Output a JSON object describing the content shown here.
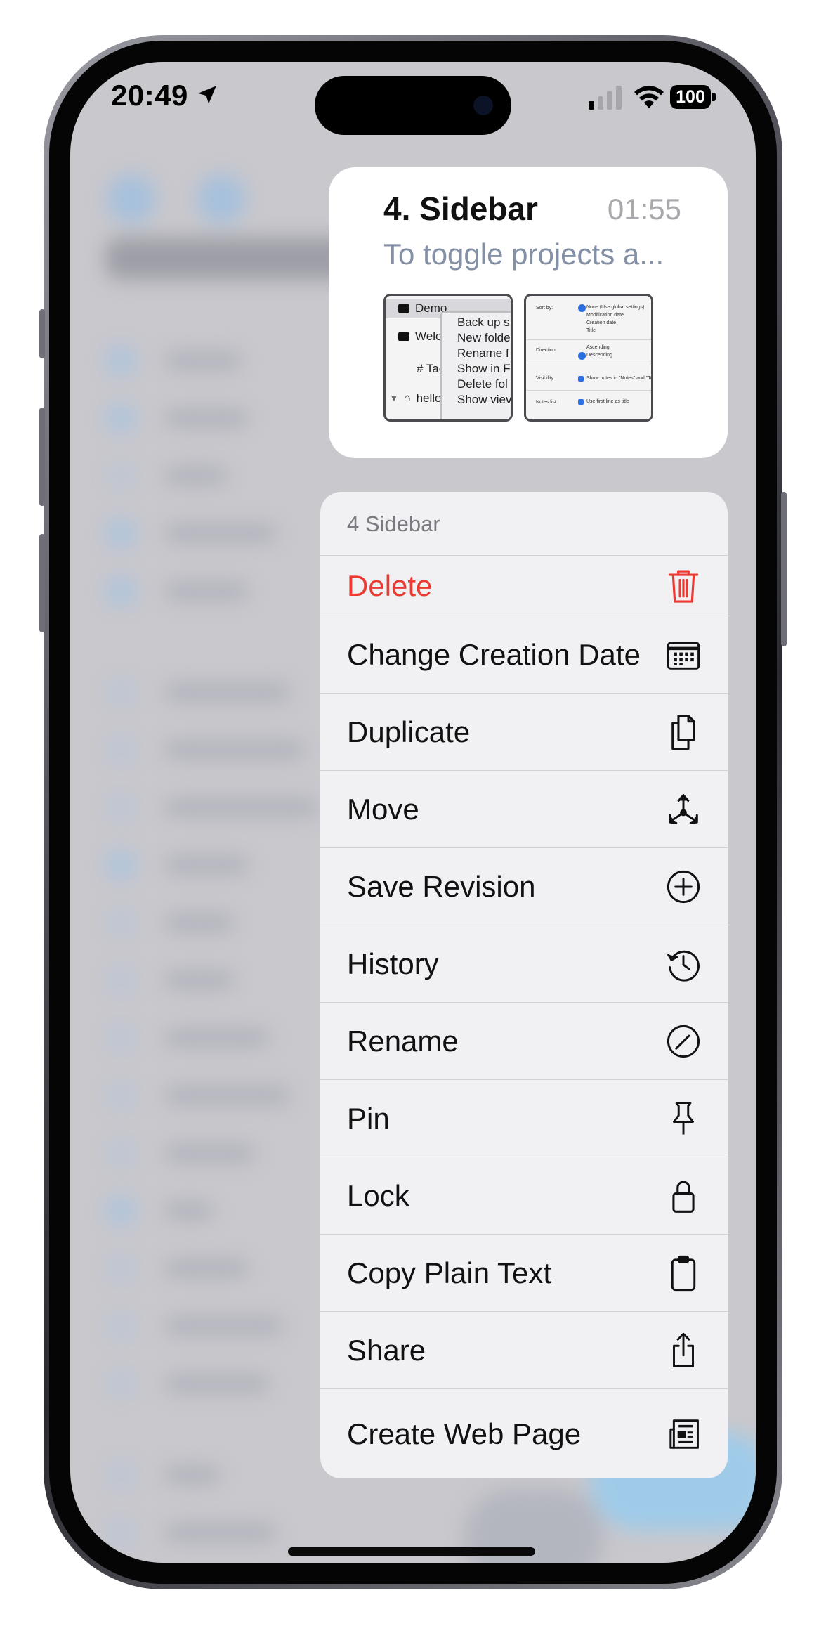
{
  "status_bar": {
    "time": "20:49",
    "battery": "100"
  },
  "preview": {
    "title": "4. Sidebar",
    "time": "01:55",
    "snippet": "To toggle projects a...",
    "thumb1": {
      "rows": [
        "Demo",
        "Welc",
        "# Tag",
        "hello"
      ],
      "menu": [
        "Back up s",
        "New folde",
        "Rename f",
        "Show in F",
        "Delete fol",
        "Show viev"
      ]
    },
    "thumb2": {
      "sort_label": "Sort by:",
      "sort_options": [
        "None (Use global settings)",
        "Modification date",
        "Creation date",
        "Title"
      ],
      "direction_label": "Direction:",
      "direction_options": [
        "Ascending",
        "Descending"
      ],
      "visibility_label": "Visibility:",
      "visibility_text": "Show notes in \"Notes\" and \"To",
      "noteslist_label": "Notes list:",
      "noteslist_text": "Use first line as title"
    }
  },
  "menu": {
    "header": "4 Sidebar",
    "items": [
      {
        "label": "Delete",
        "icon": "trash-icon",
        "danger": true
      },
      {
        "label": "Change Creation Date",
        "icon": "calendar-icon"
      },
      {
        "label": "Duplicate",
        "icon": "duplicate-icon"
      },
      {
        "label": "Move",
        "icon": "move-icon"
      },
      {
        "label": "Save Revision",
        "icon": "plus-circle-icon"
      },
      {
        "label": "History",
        "icon": "history-icon"
      },
      {
        "label": "Rename",
        "icon": "pencil-circle-icon"
      },
      {
        "label": "Pin",
        "icon": "pin-icon"
      },
      {
        "label": "Lock",
        "icon": "lock-icon"
      },
      {
        "label": "Copy Plain Text",
        "icon": "clipboard-icon"
      },
      {
        "label": "Share",
        "icon": "share-icon"
      },
      {
        "label": "Create Web Page",
        "icon": "web-page-icon"
      }
    ]
  },
  "colors": {
    "danger": "#ec3a33",
    "snippet": "#8490a5",
    "menu_bg": "#f1f0f3"
  }
}
